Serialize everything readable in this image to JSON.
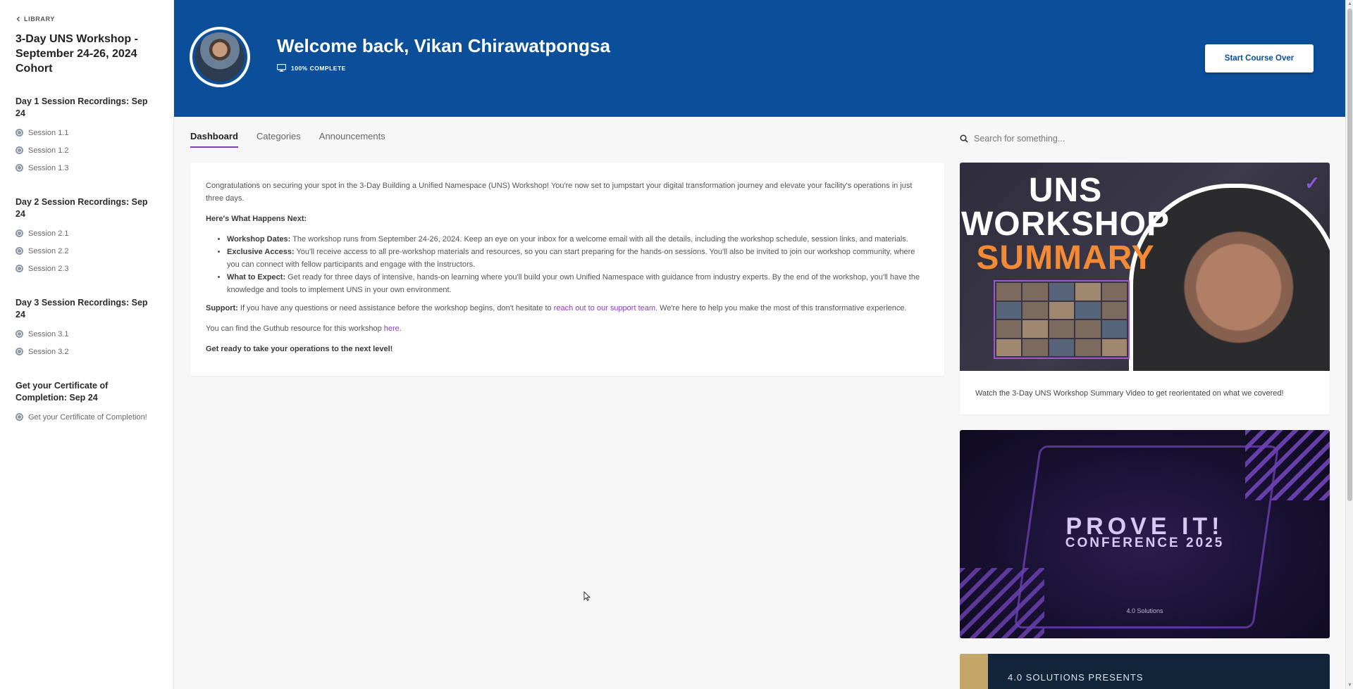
{
  "sidebar": {
    "back_label": "LIBRARY",
    "course_title": "3-Day UNS Workshop - September 24-26, 2024 Cohort",
    "sections": [
      {
        "title": "Day 1 Session Recordings: Sep 24",
        "lessons": [
          "Session 1.1",
          "Session 1.2",
          "Session 1.3"
        ]
      },
      {
        "title": "Day 2 Session Recordings: Sep 24",
        "lessons": [
          "Session 2.1",
          "Session 2.2",
          "Session 2.3"
        ]
      },
      {
        "title": "Day 3 Session Recordings: Sep 24",
        "lessons": [
          "Session 3.1",
          "Session 3.2"
        ]
      },
      {
        "title": "Get your Certificate of Completion: Sep 24",
        "lessons": [
          "Get your Certificate of Completion!"
        ]
      }
    ]
  },
  "header": {
    "welcome": "Welcome back, Vikan Chirawatpongsa",
    "progress_label": "100% COMPLETE",
    "start_over_button": "Start Course Over",
    "background_color": "#0b4f9a"
  },
  "tabs": [
    {
      "label": "Dashboard",
      "active": true
    },
    {
      "label": "Categories",
      "active": false
    },
    {
      "label": "Announcements",
      "active": false
    }
  ],
  "search": {
    "placeholder": "Search for something..."
  },
  "content": {
    "intro": "Congratulations on securing your spot in the 3-Day Building a Unified Namespace (UNS) Workshop! You're now set to jumpstart your digital transformation journey and elevate your facility's operations in just three days.",
    "next_heading": "Here's What Happens Next:",
    "bullets": [
      {
        "label": "Workshop Dates:",
        "text": " The workshop runs from September 24-26, 2024. Keep an eye on your inbox for a welcome email with all the details, including the workshop schedule, session links, and materials."
      },
      {
        "label": "Exclusive Access:",
        "text": " You'll receive access to all pre-workshop materials and resources, so you can start preparing for the hands-on sessions. You'll also be invited to join our workshop community, where you can connect with fellow participants and engage with the instructors."
      },
      {
        "label": "What to Expect:",
        "text": " Get ready for three days of intensive, hands-on learning where you'll build your own Unified Namespace with guidance from industry experts. By the end of the workshop, you'll have the knowledge and tools to implement UNS in your own environment."
      }
    ],
    "support_label": "Support:",
    "support_text_before": " If you have any questions or need assistance before the workshop begins, don't hesitate to ",
    "support_link": "reach out to our support team",
    "support_text_after": ". We're here to help you make the most of this transformative experience.",
    "github_before": "You can find the Guthub resource for this workshop ",
    "github_link": "here",
    "github_after": ".",
    "closing": "Get ready to take your operations to the next level!",
    "link_color": "#8a3fbd"
  },
  "cards": {
    "summary_video": {
      "thumb_line1": "UNS",
      "thumb_line2": "WORKSHOP",
      "thumb_line3": "SUMMARY",
      "caption": "Watch the 3-Day UNS Workshop Summary Video to get reorientated on what we covered!"
    },
    "conference": {
      "title": "PROVE IT!",
      "subtitle": "CONFERENCE 2025",
      "logo_text": "4.0 Solutions"
    },
    "presents": {
      "text": "4.0 SOLUTIONS PRESENTS"
    }
  },
  "icons": {
    "back": "chevron-left-icon",
    "progress": "monitor-icon",
    "search": "search-icon",
    "lesson": "lesson-status-icon"
  }
}
